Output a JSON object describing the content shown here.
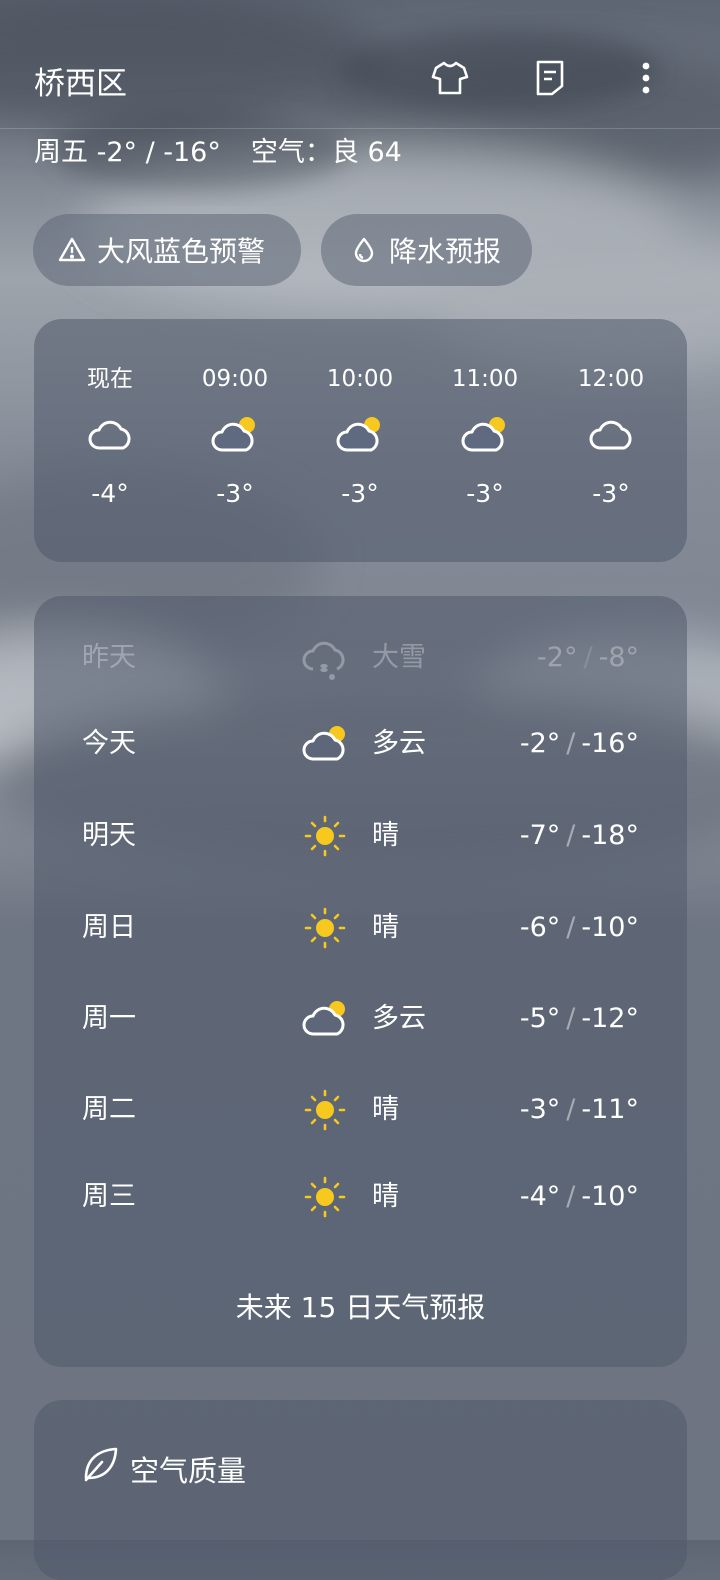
{
  "header": {
    "city": "桥西区",
    "summary_day": "周五 -2° / -16°",
    "summary_air": "空气：良 64"
  },
  "chips": [
    {
      "label": "大风蓝色预警",
      "icon": "warning-triangle-icon"
    },
    {
      "label": "降水预报",
      "icon": "raindrop-icon"
    }
  ],
  "hourly": [
    {
      "time": "现在",
      "icon": "cloudy-icon",
      "temp": "-4°"
    },
    {
      "time": "09:00",
      "icon": "partly-cloudy-icon",
      "temp": "-3°"
    },
    {
      "time": "10:00",
      "icon": "partly-cloudy-icon",
      "temp": "-3°"
    },
    {
      "time": "11:00",
      "icon": "partly-cloudy-icon",
      "temp": "-3°"
    },
    {
      "time": "12:00",
      "icon": "cloudy-icon",
      "temp": "-3°"
    }
  ],
  "daily": [
    {
      "day": "昨天",
      "icon": "heavy-snow-icon",
      "condition": "大雪",
      "high": "-2°",
      "low": "-8°"
    },
    {
      "day": "今天",
      "icon": "partly-cloudy-icon",
      "condition": "多云",
      "high": "-2°",
      "low": "-16°"
    },
    {
      "day": "明天",
      "icon": "sunny-icon",
      "condition": "晴",
      "high": "-7°",
      "low": "-18°"
    },
    {
      "day": "周日",
      "icon": "sunny-icon",
      "condition": "晴",
      "high": "-6°",
      "low": "-10°"
    },
    {
      "day": "周一",
      "icon": "partly-cloudy-icon",
      "condition": "多云",
      "high": "-5°",
      "low": "-12°"
    },
    {
      "day": "周二",
      "icon": "sunny-icon",
      "condition": "晴",
      "high": "-3°",
      "low": "-11°"
    },
    {
      "day": "周三",
      "icon": "sunny-icon",
      "condition": "晴",
      "high": "-4°",
      "low": "-10°"
    }
  ],
  "forecast_link": "未来 15 日天气预报",
  "air_quality": {
    "title": "空气质量",
    "icon": "leaf-icon"
  },
  "colors": {
    "sun": "#f7c81d",
    "card": "#56607a"
  }
}
